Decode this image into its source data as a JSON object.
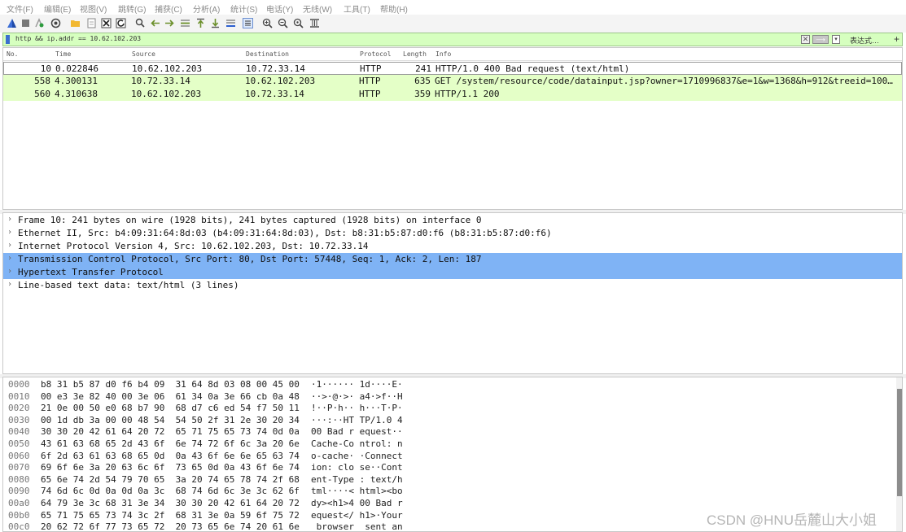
{
  "menu": [
    "文件(F)",
    "编辑(E)",
    "视图(V)",
    "跳转(G)",
    "捕获(C)",
    "分析(A)",
    "统计(S)",
    "电话(Y)",
    "无线(W)",
    "工具(T)",
    "帮助(H)"
  ],
  "filter": {
    "value": "http && ip.addr == 10.62.102.203",
    "expression_label": "表达式…",
    "plus_label": "+"
  },
  "packet_list": {
    "columns": [
      "No.",
      "Time",
      "Source",
      "Destination",
      "Protocol",
      "Length",
      "Info"
    ],
    "rows": [
      {
        "no": "10",
        "time": "0.022846",
        "src": "10.62.102.203",
        "dst": "10.72.33.14",
        "proto": "HTTP",
        "len": "241",
        "info": "HTTP/1.0 400 Bad request  (text/html)",
        "bg": "#ffffff"
      },
      {
        "no": "558",
        "time": "4.300131",
        "src": "10.72.33.14",
        "dst": "10.62.102.203",
        "proto": "HTTP",
        "len": "635",
        "info": "GET /system/resource/code/datainput.jsp?owner=1710996837&e=1&w=1368&h=912&treeid=100…",
        "bg": "#e4ffc7"
      },
      {
        "no": "560",
        "time": "4.310638",
        "src": "10.62.102.203",
        "dst": "10.72.33.14",
        "proto": "HTTP",
        "len": "359",
        "info": "HTTP/1.1 200",
        "bg": "#e4ffc7"
      }
    ]
  },
  "details": [
    {
      "text": "Frame 10: 241 bytes on wire (1928 bits), 241 bytes captured (1928 bits) on interface 0",
      "highlighted": false
    },
    {
      "text": "Ethernet II, Src: b4:09:31:64:8d:03 (b4:09:31:64:8d:03), Dst: b8:31:b5:87:d0:f6 (b8:31:b5:87:d0:f6)",
      "highlighted": false
    },
    {
      "text": "Internet Protocol Version 4, Src: 10.62.102.203, Dst: 10.72.33.14",
      "highlighted": false
    },
    {
      "text": "Transmission Control Protocol, Src Port: 80, Dst Port: 57448, Seq: 1, Ack: 2, Len: 187",
      "highlighted": true
    },
    {
      "text": "Hypertext Transfer Protocol",
      "highlighted": true
    },
    {
      "text": "Line-based text data: text/html (3 lines)",
      "highlighted": false
    }
  ],
  "bytes": [
    {
      "offset": "0000",
      "hex": "b8 31 b5 87 d0 f6 b4 09  31 64 8d 03 08 00 45 00",
      "ascii": "·1······ 1d····E·"
    },
    {
      "offset": "0010",
      "hex": "00 e3 3e 82 40 00 3e 06  61 34 0a 3e 66 cb 0a 48",
      "ascii": "··>·@·>· a4·>f··H"
    },
    {
      "offset": "0020",
      "hex": "21 0e 00 50 e0 68 b7 90  68 d7 c6 ed 54 f7 50 11",
      "ascii": "!··P·h·· h···T·P·"
    },
    {
      "offset": "0030",
      "hex": "00 1d db 3a 00 00 48 54  54 50 2f 31 2e 30 20 34",
      "ascii": "···:··HT TP/1.0 4"
    },
    {
      "offset": "0040",
      "hex": "30 30 20 42 61 64 20 72  65 71 75 65 73 74 0d 0a",
      "ascii": "00 Bad r equest··"
    },
    {
      "offset": "0050",
      "hex": "43 61 63 68 65 2d 43 6f  6e 74 72 6f 6c 3a 20 6e",
      "ascii": "Cache-Co ntrol: n"
    },
    {
      "offset": "0060",
      "hex": "6f 2d 63 61 63 68 65 0d  0a 43 6f 6e 6e 65 63 74",
      "ascii": "o-cache· ·Connect"
    },
    {
      "offset": "0070",
      "hex": "69 6f 6e 3a 20 63 6c 6f  73 65 0d 0a 43 6f 6e 74",
      "ascii": "ion: clo se··Cont"
    },
    {
      "offset": "0080",
      "hex": "65 6e 74 2d 54 79 70 65  3a 20 74 65 78 74 2f 68",
      "ascii": "ent-Type : text/h"
    },
    {
      "offset": "0090",
      "hex": "74 6d 6c 0d 0a 0d 0a 3c  68 74 6d 6c 3e 3c 62 6f",
      "ascii": "tml····< html><bo"
    },
    {
      "offset": "00a0",
      "hex": "64 79 3e 3c 68 31 3e 34  30 30 20 42 61 64 20 72",
      "ascii": "dy><h1>4 00 Bad r"
    },
    {
      "offset": "00b0",
      "hex": "65 71 75 65 73 74 3c 2f  68 31 3e 0a 59 6f 75 72",
      "ascii": "equest</ h1>·Your"
    },
    {
      "offset": "00c0",
      "hex": "20 62 72 6f 77 73 65 72  20 73 65 6e 74 20 61 6e",
      "ascii": " browser  sent an"
    }
  ],
  "watermark": "CSDN @HNU岳麓山大小姐"
}
